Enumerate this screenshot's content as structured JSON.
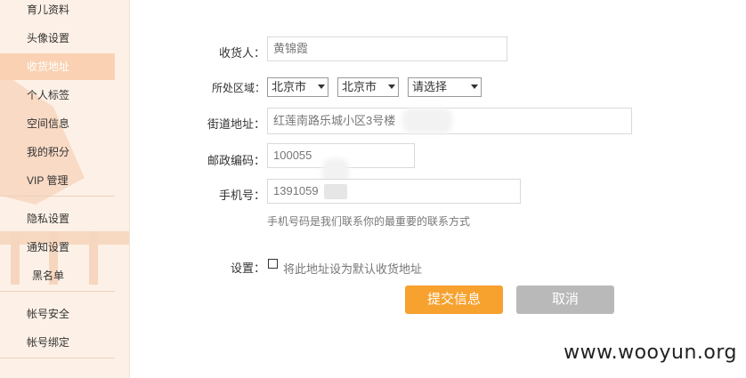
{
  "sidebar": {
    "items": [
      {
        "label": "育儿资料"
      },
      {
        "label": "头像设置"
      },
      {
        "label": "收货地址",
        "active": true
      },
      {
        "label": "个人标签"
      },
      {
        "label": "空间信息"
      },
      {
        "label": "我的积分"
      },
      {
        "label": "VIP 管理"
      },
      {
        "label": "隐私设置"
      },
      {
        "label": "通知设置"
      },
      {
        "label": "黑名单"
      },
      {
        "label": "帐号安全"
      },
      {
        "label": "帐号绑定"
      }
    ]
  },
  "form": {
    "recipient": {
      "label": "收货人：",
      "value": "黄锦霞"
    },
    "region": {
      "label": "所处区域：",
      "province": "北京市",
      "city": "北京市",
      "district": "请选择"
    },
    "street": {
      "label": "街道地址：",
      "value": "红莲南路乐城小区3号楼"
    },
    "postcode": {
      "label": "邮政编码：",
      "value": "100055"
    },
    "phone": {
      "label": "手机号：",
      "value": "1391059",
      "hint": "手机号码是我们联系你的最重要的联系方式"
    },
    "settings": {
      "label": "设置：",
      "checkbox_label": "将此地址设为默认收货地址",
      "checked": false
    },
    "submit_label": "提交信息",
    "cancel_label": "取消"
  },
  "watermark": "www.wooyun.org"
}
